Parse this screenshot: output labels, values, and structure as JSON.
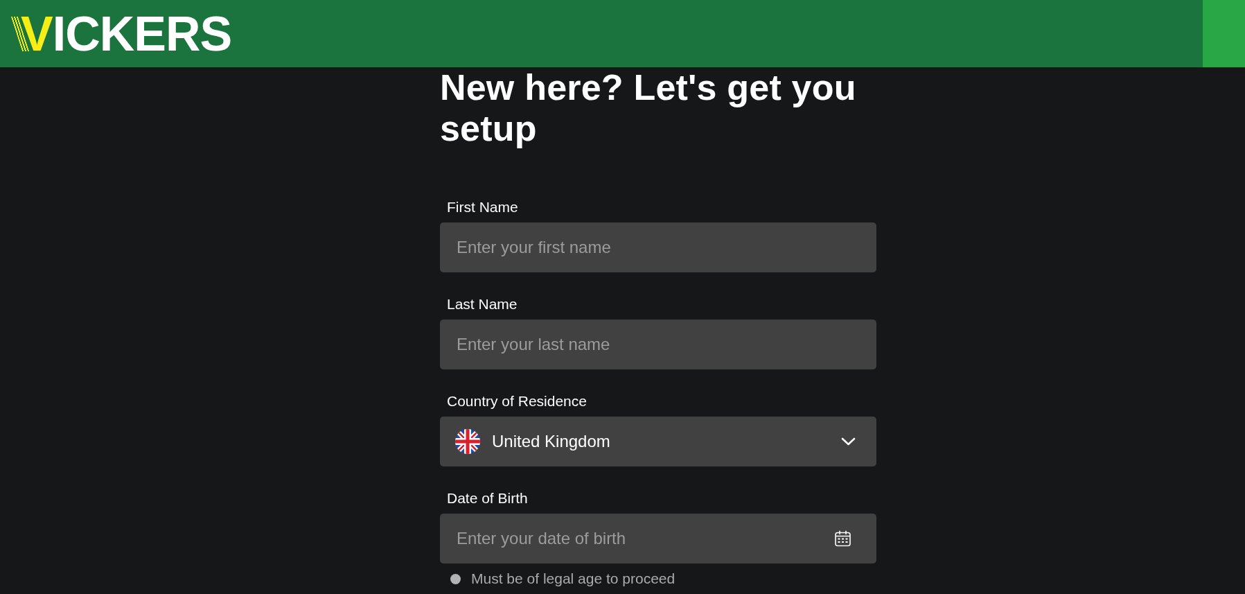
{
  "header": {
    "logo": {
      "accent": "V",
      "text": "ICKERS"
    }
  },
  "heading": "New here? Let's get you setup",
  "form": {
    "fields": [
      {
        "kind": "text",
        "label": "First Name",
        "placeholder": "Enter your first name"
      },
      {
        "kind": "text",
        "label": "Last Name",
        "placeholder": "Enter your last name"
      },
      {
        "kind": "select",
        "label": "Country of Residence",
        "value": "United Kingdom"
      },
      {
        "kind": "date",
        "label": "Date of Birth",
        "placeholder": "Enter your date of birth",
        "hint": "Must be of legal age to proceed"
      }
    ]
  }
}
